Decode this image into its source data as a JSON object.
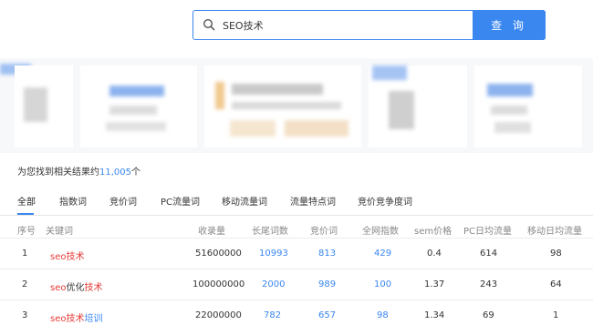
{
  "search": {
    "value": "SEO技术",
    "button_label": "查 询"
  },
  "results": {
    "prefix": "为您找到相关结果约",
    "count": "11,005",
    "suffix": "个"
  },
  "tabs": [
    {
      "label": "全部",
      "active": true
    },
    {
      "label": "指数词",
      "active": false
    },
    {
      "label": "竞价词",
      "active": false
    },
    {
      "label": "PC流量词",
      "active": false
    },
    {
      "label": "移动流量词",
      "active": false
    },
    {
      "label": "流量特点词",
      "active": false
    },
    {
      "label": "竞价竞争度词",
      "active": false
    }
  ],
  "table": {
    "headers": [
      "序号",
      "关键词",
      "收录量",
      "长尾词数",
      "竞价词",
      "全网指数",
      "sem价格",
      "PC日均流量",
      "移动日均流量"
    ],
    "rows": [
      {
        "index": "1",
        "keyword_parts": [
          "seo技术"
        ],
        "indexed": "51600000",
        "longtail": "10993",
        "bid": "813",
        "net_index": "429",
        "sem_price": "0.4",
        "pc_traffic": "614",
        "mobile_traffic": "98"
      },
      {
        "index": "2",
        "keyword_parts": [
          "seo",
          "优化",
          "技术"
        ],
        "indexed": "100000000",
        "longtail": "2000",
        "bid": "989",
        "net_index": "100",
        "sem_price": "1.37",
        "pc_traffic": "243",
        "mobile_traffic": "64"
      },
      {
        "index": "3",
        "keyword_parts": [
          "seo技术",
          "培训"
        ],
        "indexed": "22000000",
        "longtail": "782",
        "bid": "657",
        "net_index": "98",
        "sem_price": "1.34",
        "pc_traffic": "69",
        "mobile_traffic": "1"
      }
    ]
  },
  "colors": {
    "accent": "#3a87f0",
    "keyword_highlight": "#e53935"
  },
  "icons": {
    "search": "search-icon"
  }
}
